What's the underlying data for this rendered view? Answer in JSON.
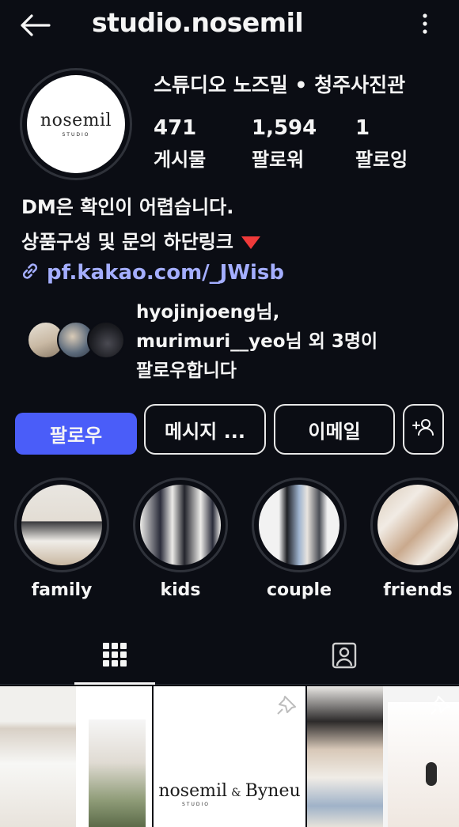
{
  "header": {
    "back_icon": "arrow-left-icon",
    "username": "studio.nosemil",
    "more_icon": "vertical-ellipsis-icon"
  },
  "profile": {
    "avatar_brand": "nosemil",
    "avatar_sub": "STUDIO",
    "display_name": "스튜디오 노즈밀 • 청주사진관",
    "stats": [
      {
        "value": "471",
        "label": "게시물"
      },
      {
        "value": "1,594",
        "label": "팔로워"
      },
      {
        "value": "1",
        "label": "팔로잉"
      }
    ]
  },
  "bio": {
    "line1": "DM은 확인이 어렵습니다.",
    "line2": "상품구성 및 문의 하단링크",
    "line2_emoji": "red-down-triangle",
    "link_icon": "link-icon",
    "link": "pf.kakao.com/_JWisb"
  },
  "followed_by": {
    "line1": "hyojinjoeng님,",
    "line2": "murimuri__yeo님 외 3명이",
    "line3": "팔로우합니다"
  },
  "actions": {
    "follow": "팔로우",
    "message": "메시지 ...",
    "email": "이메일",
    "suggest_icon": "add-person-icon"
  },
  "highlights": [
    {
      "label": "family"
    },
    {
      "label": "kids"
    },
    {
      "label": "couple"
    },
    {
      "label": "friends"
    }
  ],
  "tabs": {
    "grid_icon": "grid-icon",
    "tagged_icon": "tagged-person-icon"
  },
  "posts": {
    "tile2_brand_left": "nosemil",
    "tile2_amp": "&",
    "tile2_brand_right": "Byneu",
    "tile2_sub": "STUDIO",
    "pin_icon": "pin-icon"
  },
  "colors": {
    "background": "#0b0d14",
    "follow_button": "#4a5df9",
    "link": "#a4aeff"
  }
}
